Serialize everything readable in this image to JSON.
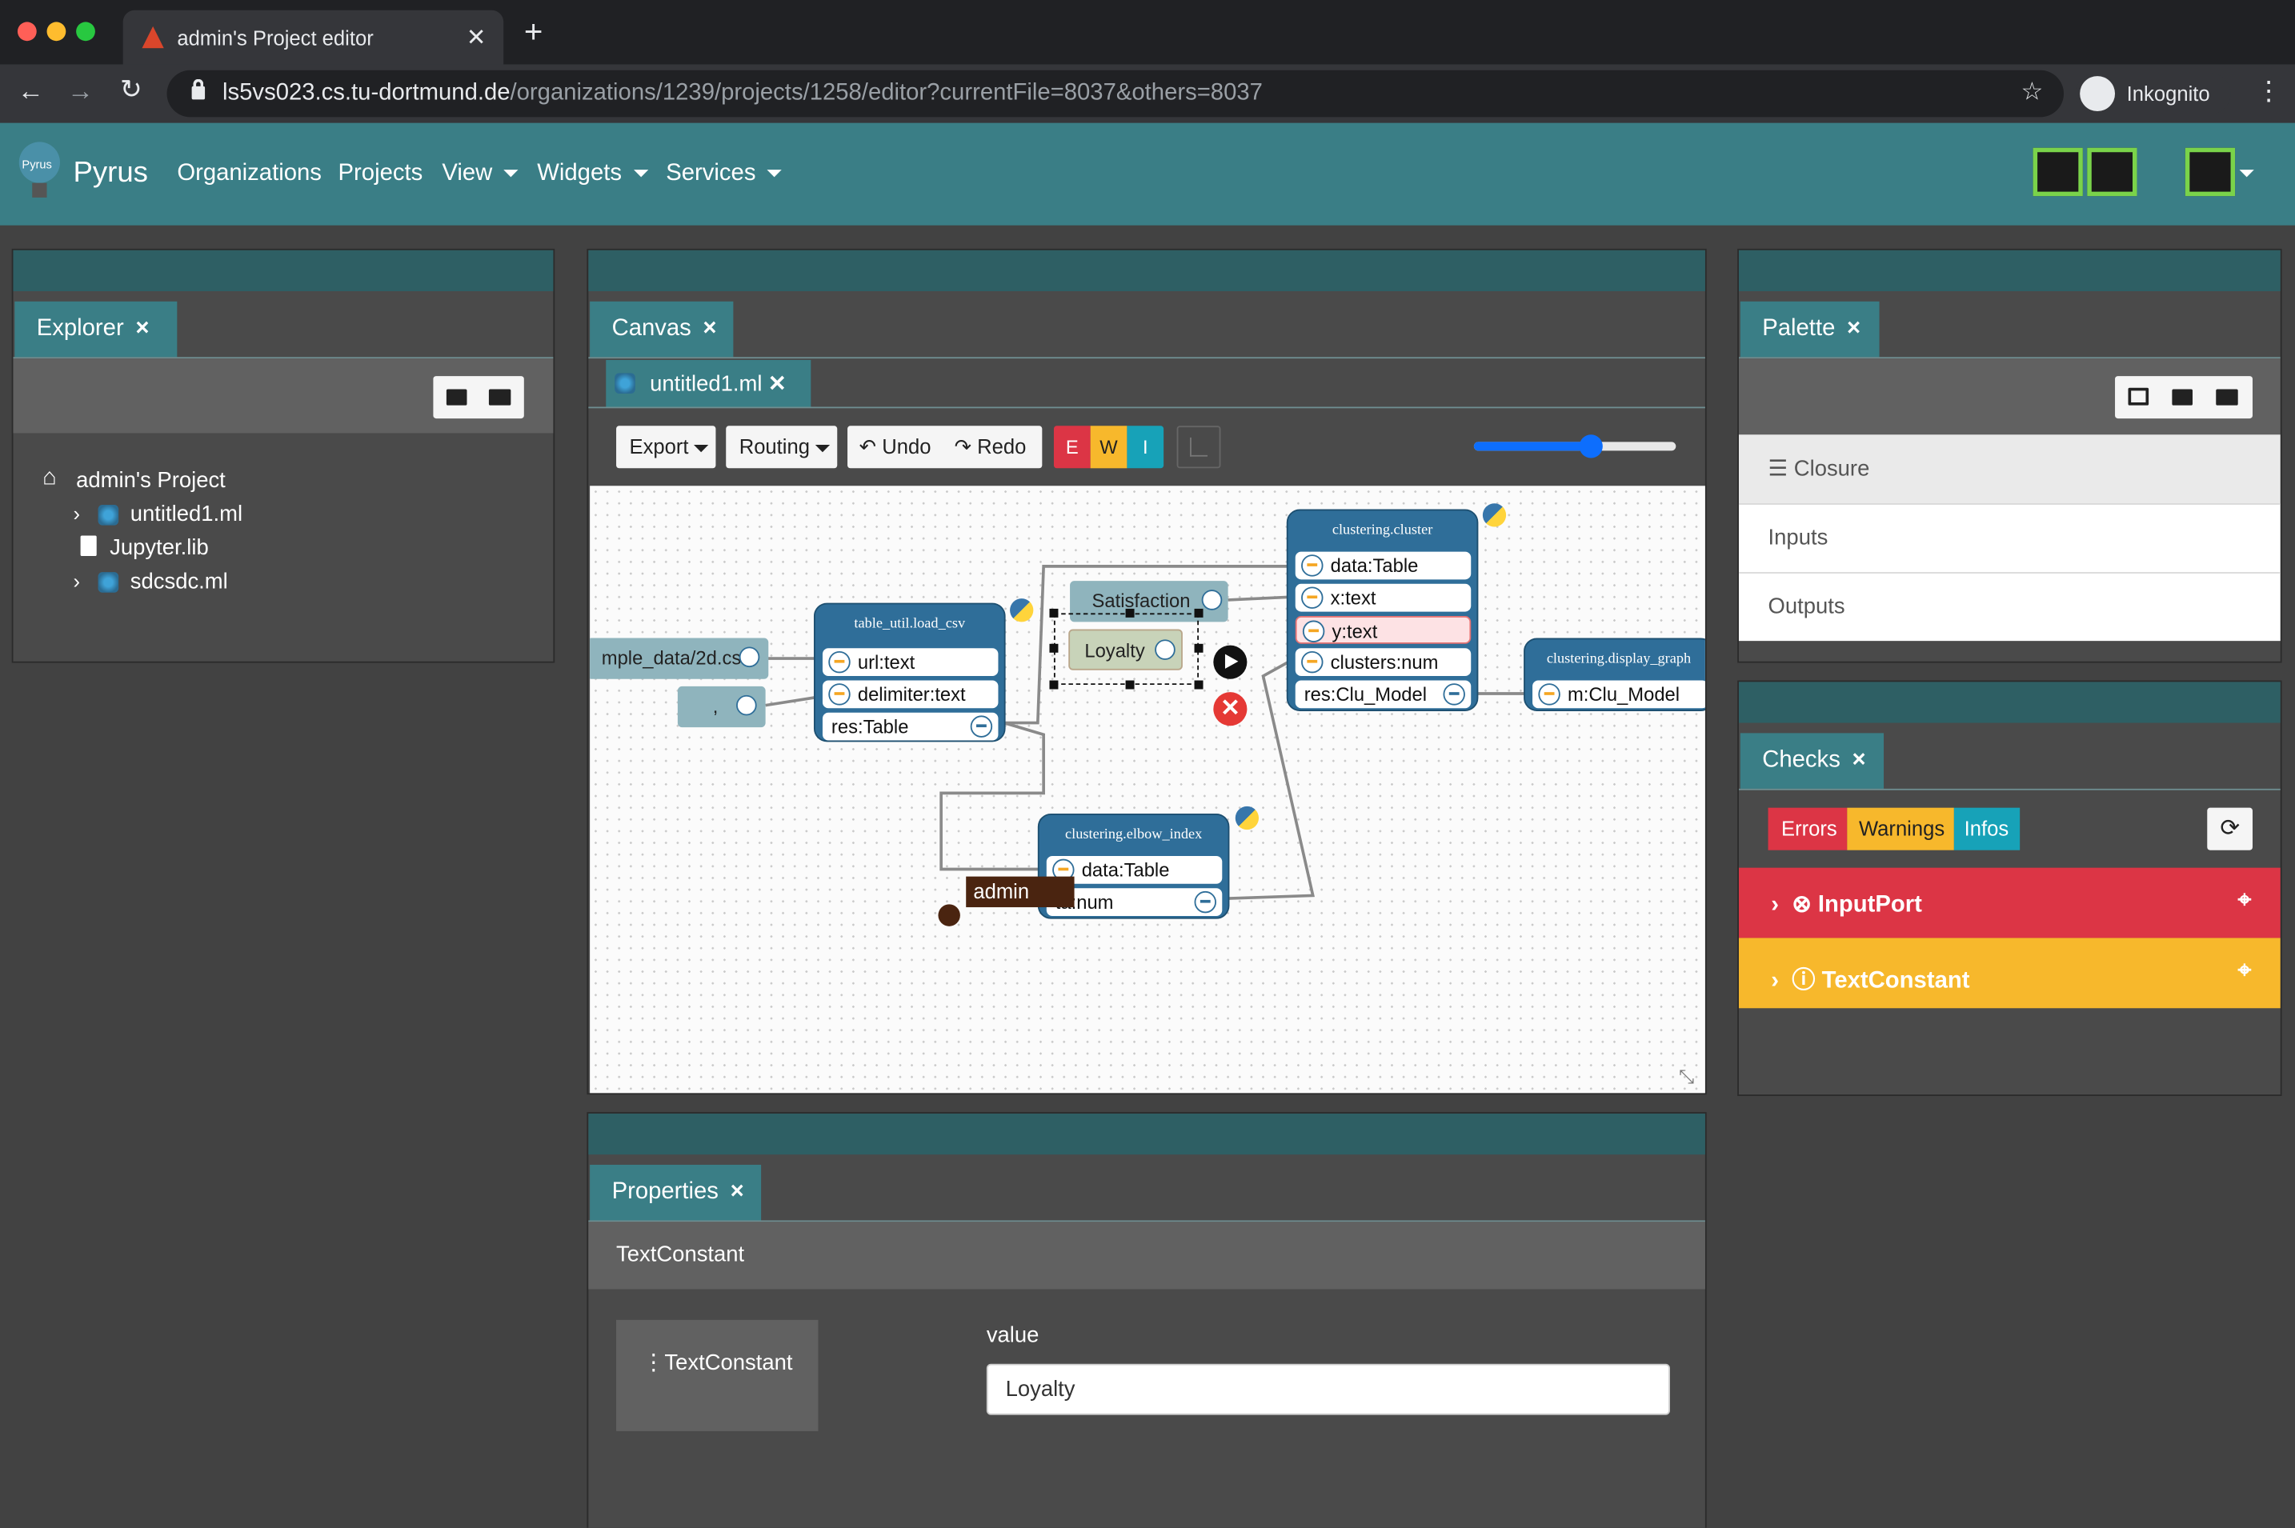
{
  "browser": {
    "tab_title": "admin's Project editor",
    "url_host": "ls5vs023.cs.tu-dortmund.de",
    "url_path": "/organizations/1239/projects/1258/editor?currentFile=8037&others=8037",
    "profile_label": "Inkognito"
  },
  "navbar": {
    "brand": "Pyrus",
    "logo_text": "Pyrus",
    "items": [
      "Organizations",
      "Projects",
      "View",
      "Widgets",
      "Services"
    ]
  },
  "explorer": {
    "tab_label": "Explorer",
    "tree": {
      "root": "admin's Project",
      "items": [
        "untitled1.ml",
        "Jupyter.lib",
        "sdcsdc.ml"
      ]
    }
  },
  "canvas": {
    "tab_label": "Canvas",
    "file_tab": "untitled1.ml",
    "toolbar": {
      "export": "Export",
      "routing": "Routing",
      "undo": "Undo",
      "redo": "Redo",
      "e": "E",
      "w": "W",
      "i": "I"
    },
    "zoom_fraction": 0.58,
    "constants": [
      "mple_data/2d.csv",
      ",",
      "Satisfaction",
      "Loyalty"
    ],
    "nodes": {
      "load_csv": {
        "title": "table_util.load_csv",
        "ports": [
          "url:text",
          "delimiter:text",
          "res:Table"
        ]
      },
      "cluster": {
        "title": "clustering.cluster",
        "ports": [
          "data:Table",
          "x:text",
          "y:text",
          "clusters:num",
          "res:Clu_Model"
        ]
      },
      "display": {
        "title": "clustering.display_graph",
        "ports": [
          "m:Clu_Model"
        ]
      },
      "elbow": {
        "title": "clustering.elbow_index",
        "ports": [
          "data:Table",
          "ta:num"
        ]
      }
    },
    "cursor_label": "admin"
  },
  "palette": {
    "tab_label": "Palette",
    "items": [
      "Closure",
      "Inputs",
      "Outputs"
    ]
  },
  "checks": {
    "tab_label": "Checks",
    "filters": [
      "Errors",
      "Warnings",
      "Infos"
    ],
    "rows": [
      {
        "label": "InputPort",
        "color": "#dc3545"
      },
      {
        "label": "TextConstant",
        "color": "#f7b82c"
      }
    ]
  },
  "properties": {
    "tab_label": "Properties",
    "header": "TextConstant",
    "card_label": "TextConstant",
    "field_label": "value",
    "field_value": "Loyalty"
  },
  "colors": {
    "navbar": "#3a7e86",
    "node": "#2f6e99",
    "error": "#dc3545",
    "warning": "#f7b82c",
    "info": "#17a2b8"
  }
}
